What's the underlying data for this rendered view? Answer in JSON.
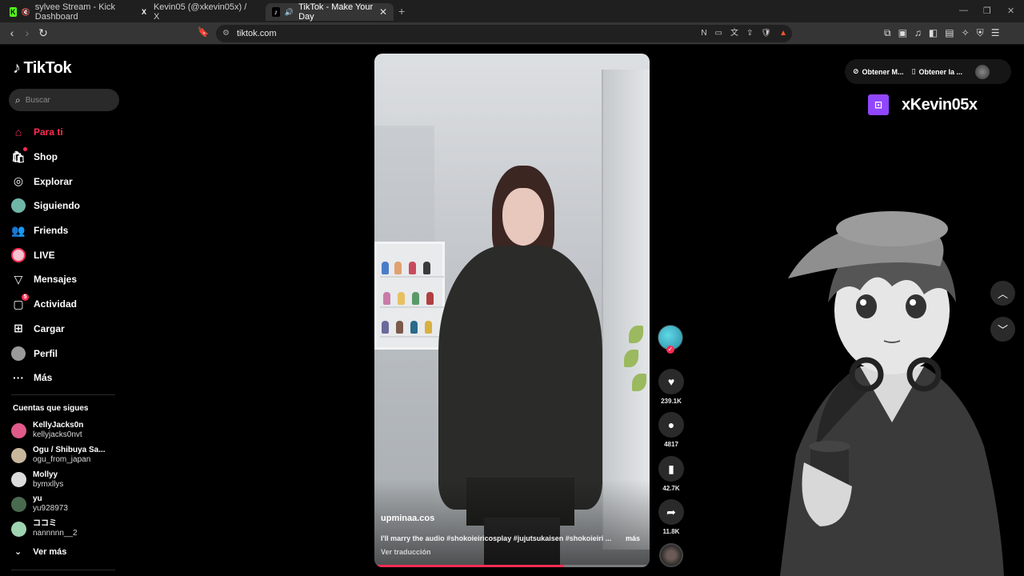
{
  "browser": {
    "tabs": [
      {
        "title": "sylvee Stream - Kick Dashboard",
        "favicon": "K",
        "favicon_color": "#53fc18",
        "active": false
      },
      {
        "title": "Kevin05 (@xkevin05x) / X",
        "favicon": "X",
        "favicon_color": "#ffffff",
        "active": false
      },
      {
        "title": "TikTok - Make Your Day",
        "favicon": "♪",
        "favicon_color": "#ffffff",
        "active": true
      }
    ],
    "url": "tiktok.com",
    "shield_badge": "1"
  },
  "sidebar": {
    "logo": "TikTok",
    "search_placeholder": "Buscar",
    "menu": [
      {
        "label": "Para ti",
        "icon": "home-icon",
        "active": true
      },
      {
        "label": "Shop",
        "icon": "shop-icon"
      },
      {
        "label": "Explorar",
        "icon": "compass-icon"
      },
      {
        "label": "Siguiendo",
        "icon": "following-avatar-icon"
      },
      {
        "label": "Friends",
        "icon": "friends-icon"
      },
      {
        "label": "LIVE",
        "icon": "live-icon"
      },
      {
        "label": "Mensajes",
        "icon": "messages-icon"
      },
      {
        "label": "Actividad",
        "icon": "activity-icon",
        "badge": "5"
      },
      {
        "label": "Cargar",
        "icon": "upload-icon"
      },
      {
        "label": "Perfil",
        "icon": "profile-icon"
      },
      {
        "label": "Más",
        "icon": "more-icon"
      }
    ],
    "following_title": "Cuentas que sigues",
    "following": [
      {
        "name": "KellyJacks0n",
        "handle": "kellyjacks0nvt",
        "color": "#e05a8a"
      },
      {
        "name": "Ogu / Shibuya Sa...",
        "handle": "ogu_from_japan",
        "color": "#c9b79c"
      },
      {
        "name": "Mollyy",
        "handle": "bymxllys",
        "color": "#dcdcdc"
      },
      {
        "name": "yu",
        "handle": "yu928973",
        "color": "#4a6a50"
      },
      {
        "name": "ココミ",
        "handle": "nannnnn__2",
        "color": "#9fd3b0"
      }
    ],
    "see_more": "Ver más"
  },
  "video": {
    "author": "upminaa.cos",
    "caption": "I'll marry the audio #shokoieiricosplay #jujutsukaisen #shokoieiri ...",
    "more": "más",
    "translate": "Ver traducción",
    "progress": 0.69
  },
  "actions": {
    "likes": "239.1K",
    "comments": "4817",
    "saves": "42.7K",
    "shares": "11.8K"
  },
  "topright": {
    "get_app_1": "Obtener M...",
    "get_app_2": "Obtener la ..."
  },
  "overlay": {
    "twitch_name": "xKevin05x",
    "twitch_color": "#9146ff"
  },
  "colors": {
    "accent": "#fe2c55",
    "background": "#000000"
  }
}
